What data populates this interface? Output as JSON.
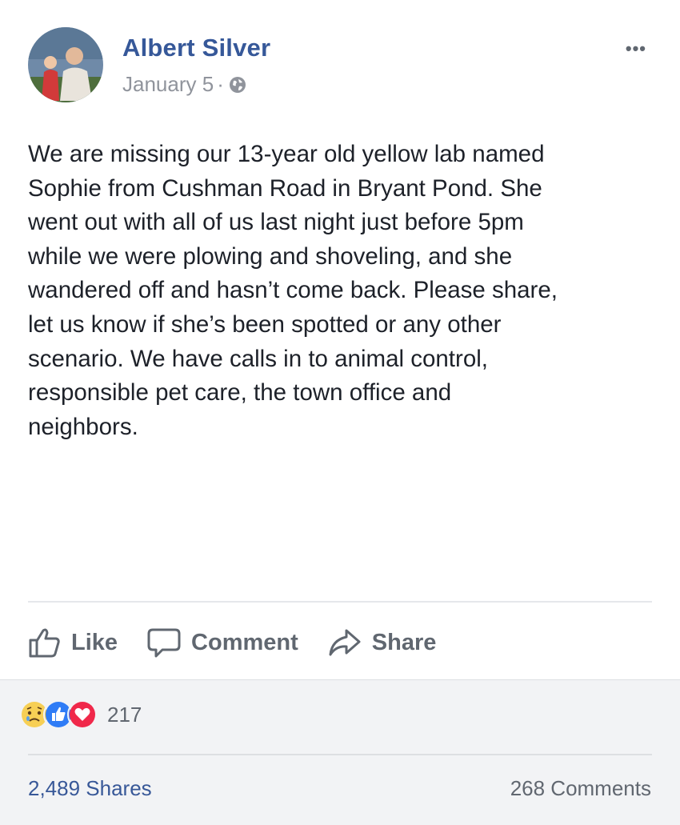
{
  "post": {
    "author": "Albert Silver",
    "date": "January 5",
    "date_separator": "·",
    "privacy_icon": "globe-icon",
    "more_label": "•••",
    "text": "We are missing our 13-year old yellow lab named\nSophie from Cushman Road in Bryant Pond. She\nwent out with all of us last night just before 5pm\nwhile we were plowing and shoveling, and she\nwandered off and hasn’t come back. Please share,\nlet us know if she’s been spotted or any other\nscenario. We have calls in to animal control,\nresponsible pet care, the town office and\nneighbors."
  },
  "actions": {
    "like_label": "Like",
    "comment_label": "Comment",
    "share_label": "Share"
  },
  "stats": {
    "reactions": [
      "sad-reaction-icon",
      "like-reaction-icon",
      "love-reaction-icon"
    ],
    "reaction_count": "217",
    "shares": "2,489 Shares",
    "comments": "268 Comments"
  },
  "colors": {
    "link_blue": "#365899",
    "meta_gray": "#90949c",
    "action_gray": "#606770",
    "footer_bg": "#f2f3f5"
  }
}
